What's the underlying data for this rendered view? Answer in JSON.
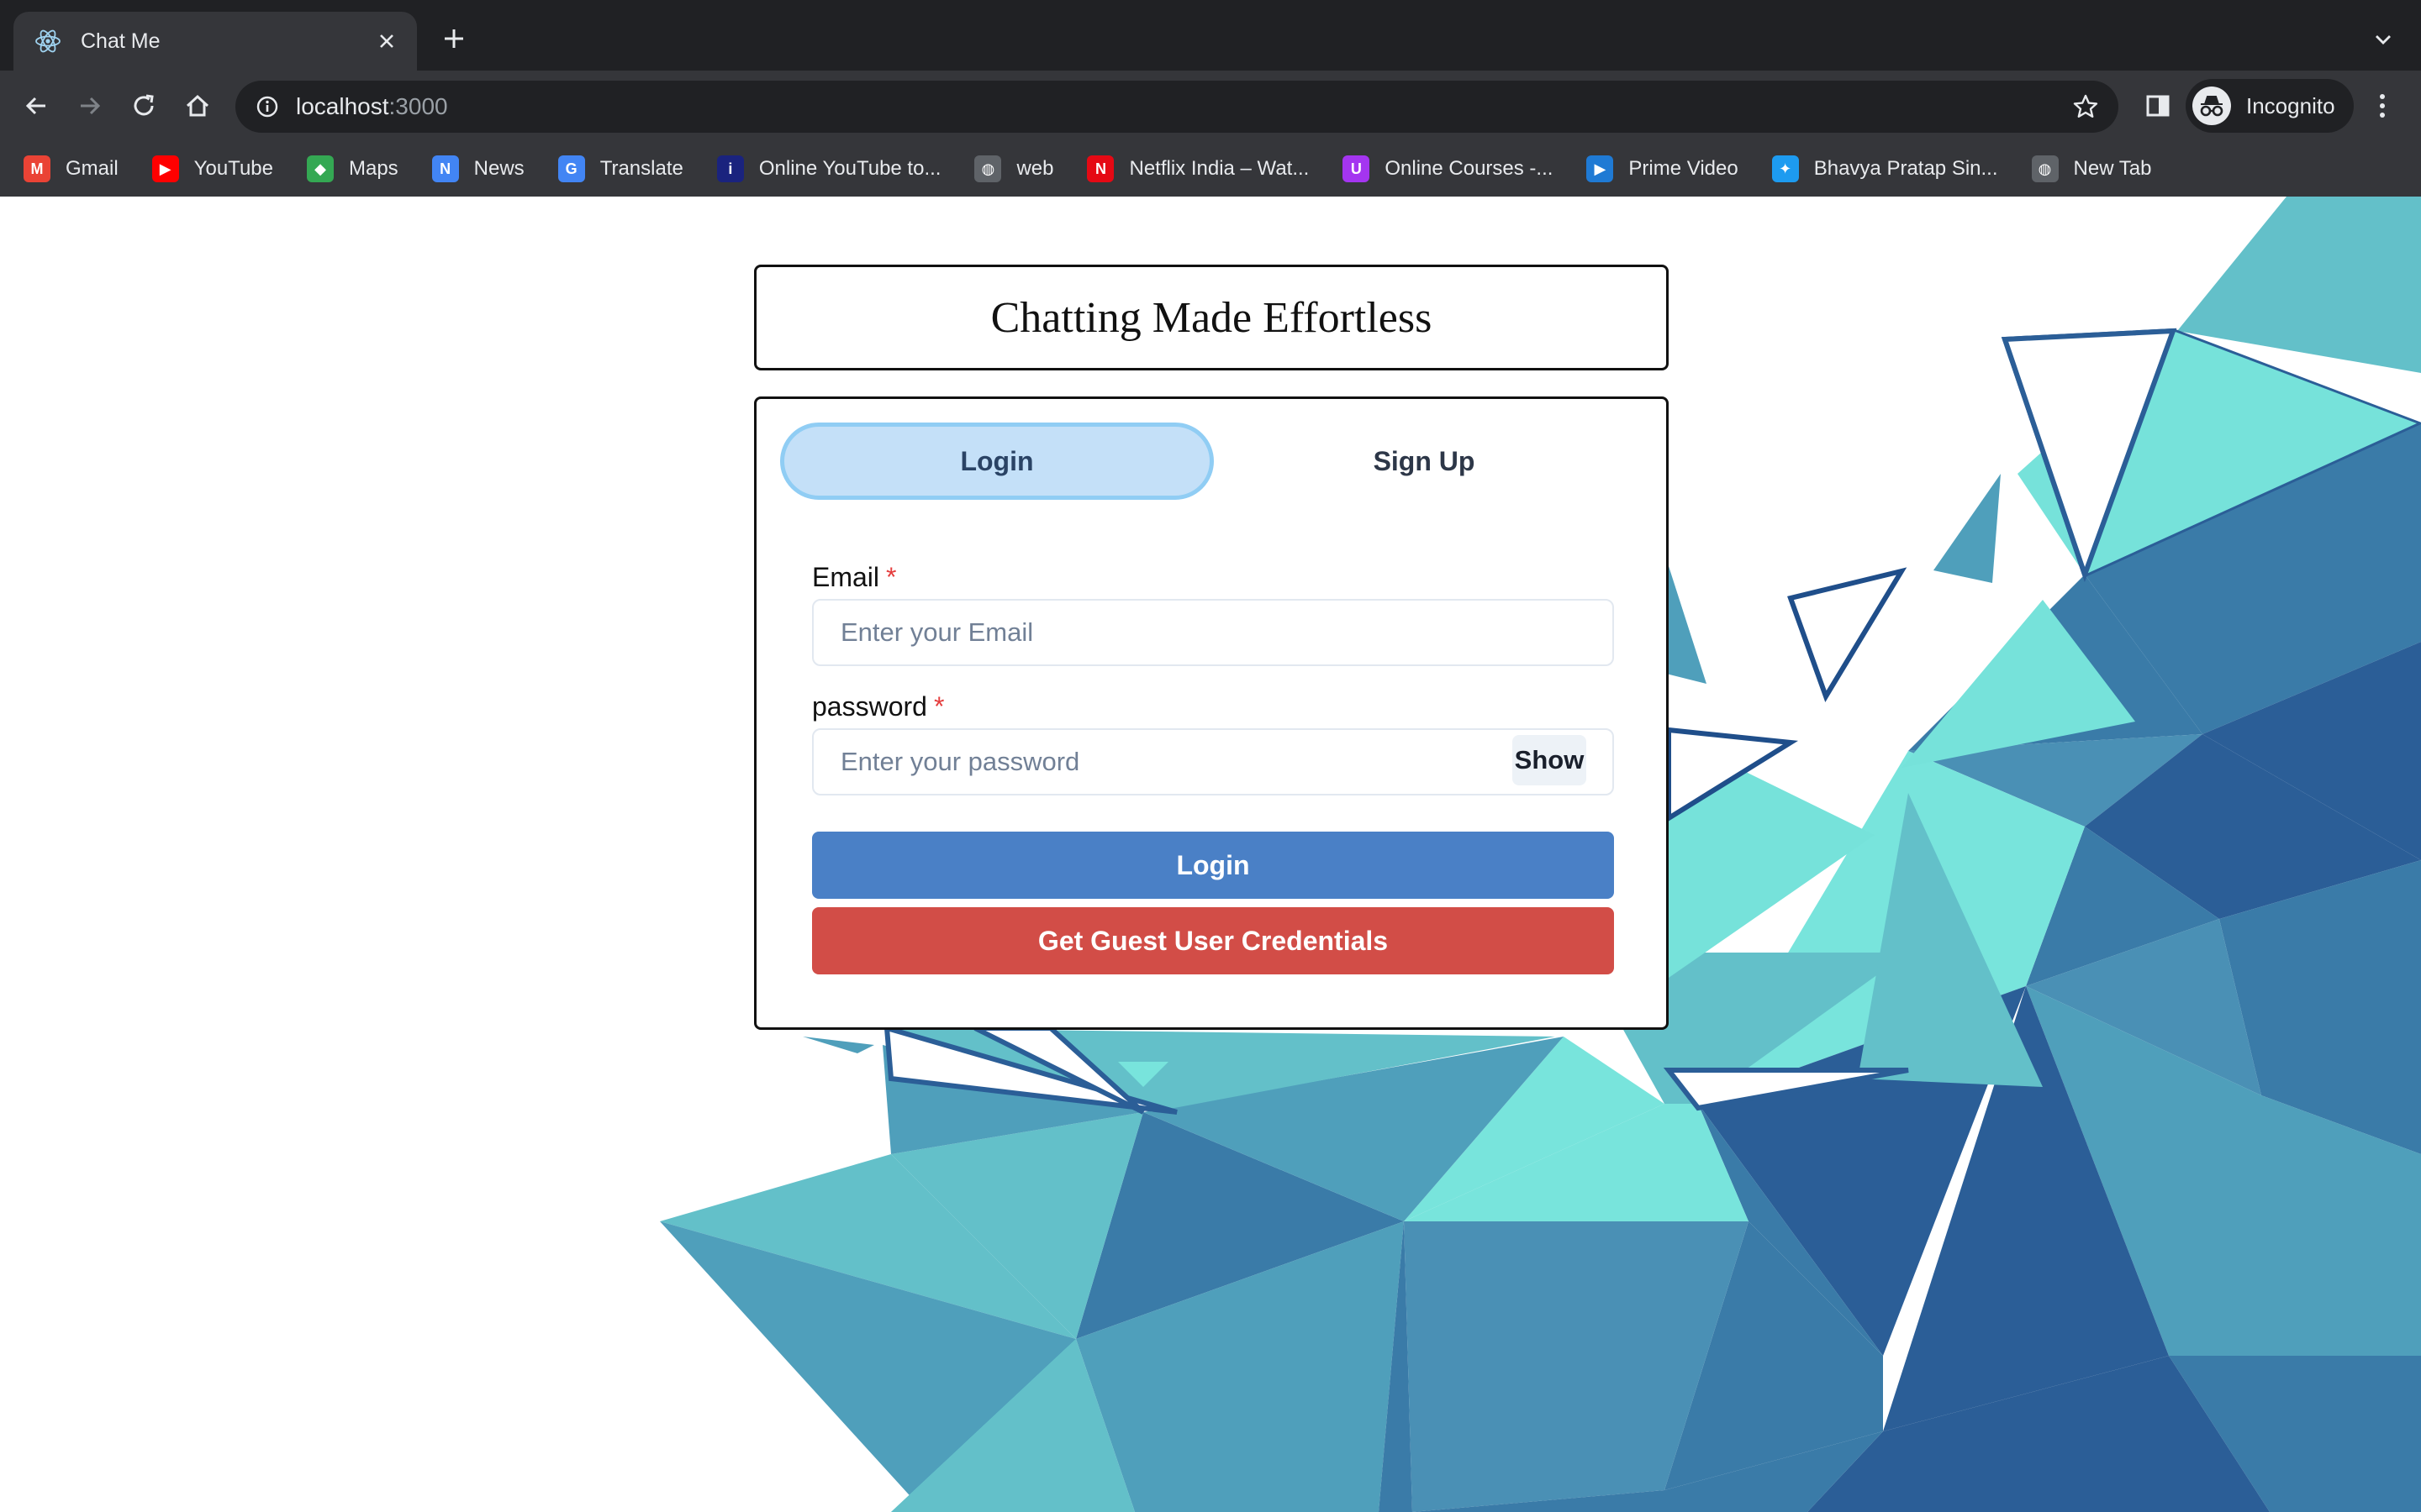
{
  "browser": {
    "tab_title": "Chat Me",
    "url_host": "localhost",
    "url_port": ":3000",
    "profile_label": "Incognito",
    "bookmarks": [
      {
        "label": "Gmail",
        "icon": "gmail-icon",
        "color": "#ea4335",
        "glyph": "M"
      },
      {
        "label": "YouTube",
        "icon": "youtube-icon",
        "color": "#ff0000",
        "glyph": "▶"
      },
      {
        "label": "Maps",
        "icon": "maps-icon",
        "color": "#34a853",
        "glyph": "◆"
      },
      {
        "label": "News",
        "icon": "news-icon",
        "color": "#4285f4",
        "glyph": "N"
      },
      {
        "label": "Translate",
        "icon": "translate-icon",
        "color": "#4285f4",
        "glyph": "G"
      },
      {
        "label": "Online YouTube to...",
        "icon": "converter-icon",
        "color": "#1a237e",
        "glyph": "i"
      },
      {
        "label": "web",
        "icon": "globe-icon",
        "color": "#5f6368",
        "glyph": "◍"
      },
      {
        "label": "Netflix India – Wat...",
        "icon": "netflix-icon",
        "color": "#e50914",
        "glyph": "N"
      },
      {
        "label": "Online Courses -...",
        "icon": "udemy-icon",
        "color": "#a435f0",
        "glyph": "U"
      },
      {
        "label": "Prime Video",
        "icon": "prime-video-icon",
        "color": "#1f7ad4",
        "glyph": "▶"
      },
      {
        "label": "Bhavya Pratap Sin...",
        "icon": "twitter-icon",
        "color": "#1d9bf0",
        "glyph": "✦"
      },
      {
        "label": "New Tab",
        "icon": "globe-icon",
        "color": "#5f6368",
        "glyph": "◍"
      }
    ]
  },
  "app": {
    "heading": "Chatting Made Effortless",
    "tabs": {
      "login": "Login",
      "signup": "Sign Up"
    },
    "email": {
      "label": "Email",
      "required_mark": "*",
      "placeholder": "Enter your Email",
      "value": ""
    },
    "password": {
      "label": "password",
      "required_mark": "*",
      "placeholder": "Enter your password",
      "value": "",
      "toggle": "Show"
    },
    "login_button": "Login",
    "guest_button": "Get Guest User Credentials"
  },
  "colors": {
    "accent": "#4a80c6",
    "danger": "#d24d47",
    "tab_active": "#c4e0f8"
  }
}
